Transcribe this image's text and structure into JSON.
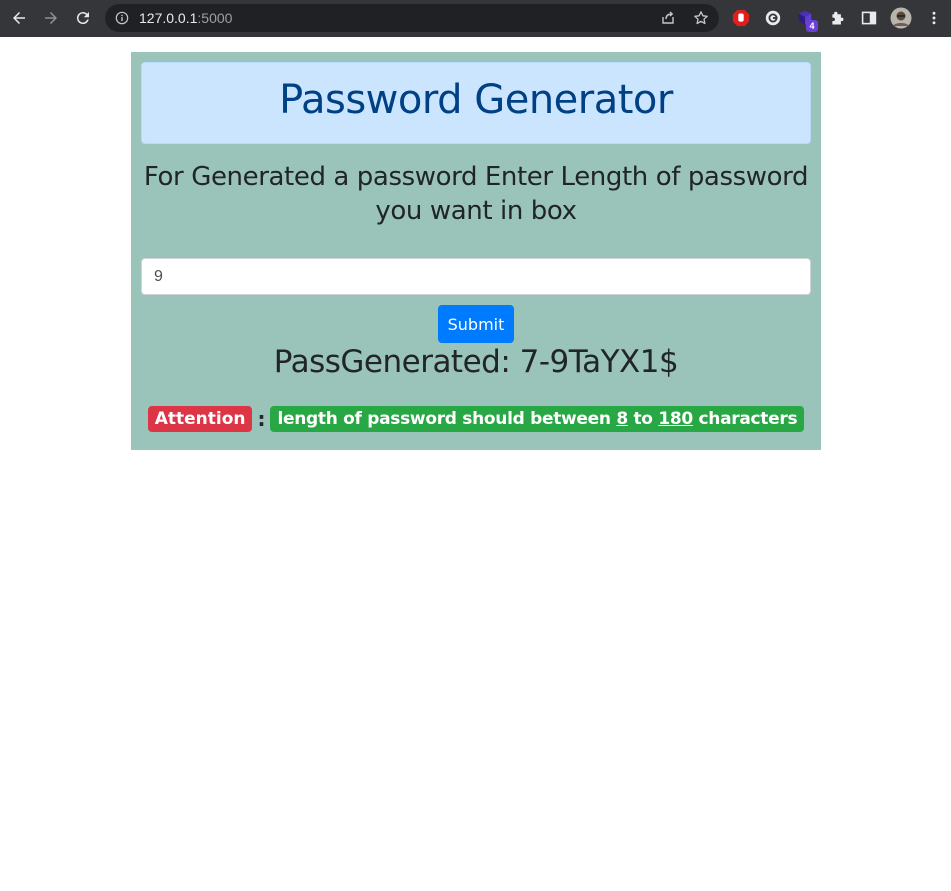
{
  "browser": {
    "url_host": "127.0.0.1",
    "url_port": ":5000",
    "extension_badge": "4",
    "icons": [
      "back-arrow-icon",
      "forward-arrow-icon",
      "reload-icon",
      "info-icon",
      "share-icon",
      "star-icon",
      "adblock-icon",
      "grammarly-icon",
      "extension-icon",
      "puzzle-icon",
      "side-panel-icon",
      "profile-avatar",
      "kebab-menu-icon"
    ]
  },
  "page": {
    "title": "Password Generator",
    "subtitle": "For Generated a password Enter Length of password you want in box",
    "input_value": "9",
    "submit_label": "Submit",
    "result_label": "PassGenerated: ",
    "result_value": "7-9TaYX1$",
    "attention_label": "Attention",
    "separator": ":",
    "note_prefix": "length of password should between ",
    "note_min": "8",
    "note_mid": " to ",
    "note_max": "180",
    "note_suffix": " characters"
  },
  "colors": {
    "card_bg": "#9ac4b9",
    "title_bg": "#cce5ff",
    "title_text": "#004085",
    "submit_bg": "#007bff",
    "attention_bg": "#dc3545",
    "note_bg": "#28a745"
  }
}
